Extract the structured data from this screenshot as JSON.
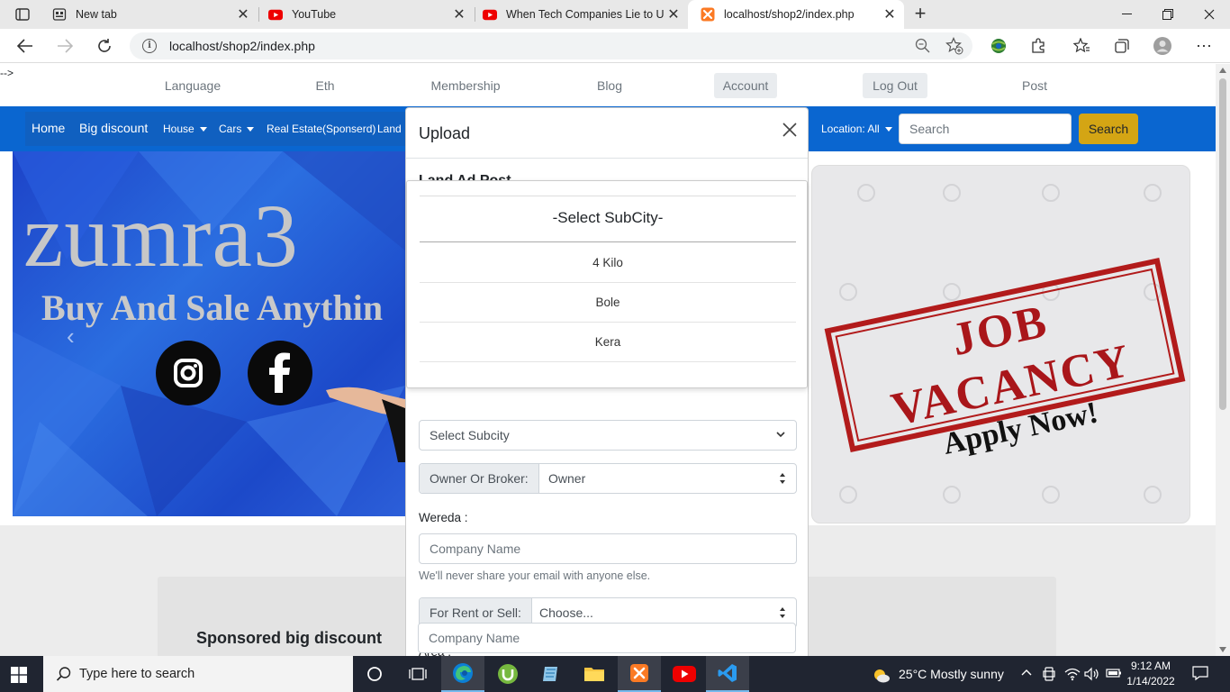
{
  "browser": {
    "tabs": [
      {
        "title": "New tab",
        "icon": "newtab-icon"
      },
      {
        "title": "YouTube",
        "icon": "youtube-icon"
      },
      {
        "title": "When Tech Companies Lie to Us",
        "icon": "youtube-icon"
      },
      {
        "title": "localhost/shop2/index.php",
        "icon": "xampp-icon",
        "active": true
      }
    ],
    "url": "localhost/shop2/index.php"
  },
  "page": {
    "stray_comment": "-->",
    "top_menu": [
      "Language",
      "Eth",
      "Membership",
      "Blog",
      "Account",
      "Log Out",
      "Post"
    ],
    "nav": {
      "home": "Home",
      "big_discount": "Big discount",
      "house": "House",
      "cars": "Cars",
      "real_estate": "Real Estate(Sponserd)",
      "land": "Land",
      "location": "Location: All",
      "search_placeholder": "Search",
      "search_button": "Search"
    },
    "hero": {
      "brand": "zumra3",
      "tagline": "Buy And Sale Anythin"
    },
    "banner": {
      "line1": "JOB VACANCY",
      "line2": "Apply Now!"
    },
    "sponsored_title": "Sponsored big discount"
  },
  "modal": {
    "title": "Upload",
    "subtitle": "Land Ad Post",
    "subcity_select": "Select Subcity",
    "owner_label": "Owner Or Broker:",
    "owner_value": "Owner",
    "wereda_label": "Wereda :",
    "wereda_placeholder": "Company Name",
    "help_text": "We'll never share your email with anyone else.",
    "rent_label": "For Rent or Sell:",
    "rent_value": "Choose...",
    "area_label": "Area :",
    "area_placeholder": "Company Name"
  },
  "dropdown": {
    "header": "-Select SubCity-",
    "options": [
      "4 Kilo",
      "Bole",
      "Kera"
    ]
  },
  "taskbar": {
    "search_placeholder": "Type here to search",
    "weather": "25°C  Mostly sunny",
    "time": "9:12 AM",
    "date": "1/14/2022"
  }
}
